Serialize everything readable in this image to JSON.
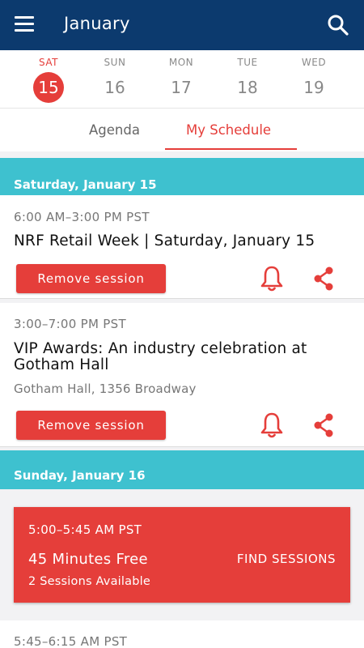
{
  "header": {
    "title": "January",
    "menu_icon": "hamburger-menu-icon",
    "search_icon": "search-icon"
  },
  "days": [
    {
      "name": "SAT",
      "num": "15",
      "active": true
    },
    {
      "name": "SUN",
      "num": "16",
      "active": false
    },
    {
      "name": "MON",
      "num": "17",
      "active": false
    },
    {
      "name": "TUE",
      "num": "18",
      "active": false
    },
    {
      "name": "WED",
      "num": "19",
      "active": false
    }
  ],
  "tabs": {
    "agenda": "Agenda",
    "my_schedule": "My Schedule",
    "active": "my_schedule"
  },
  "sections": [
    {
      "header": "Saturday, January 15"
    },
    {
      "header": "Sunday, January 16"
    }
  ],
  "sessions": [
    {
      "time": "6:00 AM–3:00 PM PST",
      "title": "NRF Retail Week | Saturday, January 15",
      "button": "Remove session"
    },
    {
      "time": "3:00–7:00 PM PST",
      "title": "VIP Awards: An industry celebration at Gotham Hall",
      "location": "Gotham Hall, 1356 Broadway",
      "button": "Remove session"
    }
  ],
  "free_slot": {
    "time": "5:00–5:45 AM PST",
    "title": "45 Minutes Free",
    "subtitle": "2 Sessions Available",
    "action": "FIND SESSIONS"
  },
  "next_session": {
    "time": "5:45–6:15 AM PST"
  },
  "colors": {
    "appbar": "#0c3a6e",
    "accent": "#e53e3a",
    "section": "#3ec1cf"
  }
}
